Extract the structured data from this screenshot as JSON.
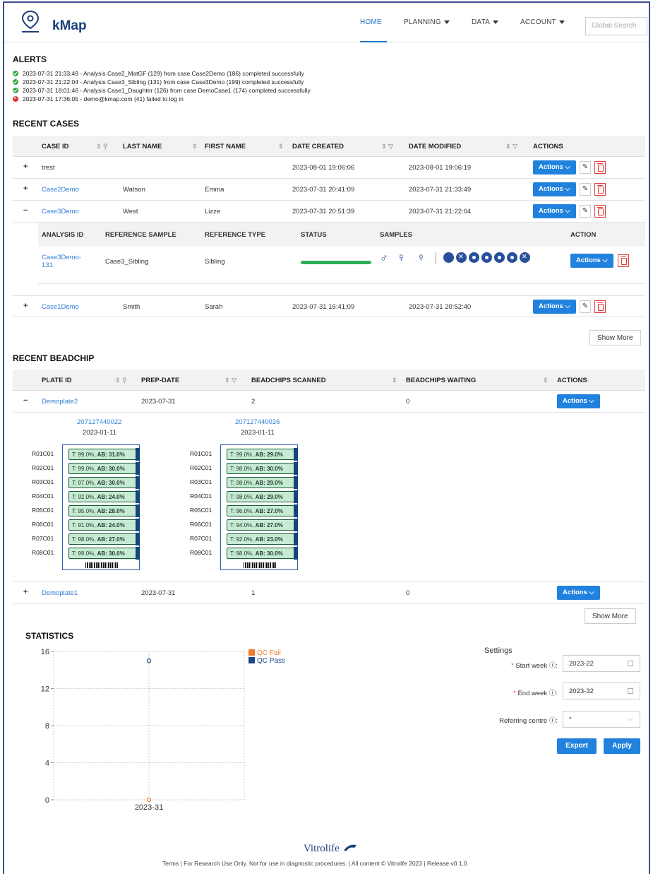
{
  "header": {
    "brand": "kMap",
    "nav": [
      {
        "label": "HOME",
        "dropdown": false,
        "active": true
      },
      {
        "label": "PLANNING",
        "dropdown": true
      },
      {
        "label": "DATA",
        "dropdown": true
      },
      {
        "label": "ACCOUNT",
        "dropdown": true
      }
    ],
    "search_placeholder": "Global Search"
  },
  "alerts": {
    "title": "ALERTS",
    "items": [
      {
        "status": "success",
        "text": "2023-07-31 21:33:49 - Analysis Case2_MatGF (129) from case Case2Demo (186) completed successfully"
      },
      {
        "status": "success",
        "text": "2023-07-31 21:22:04 - Analysis Case3_Sibling (131) from case Case3Demo (199) completed successfully"
      },
      {
        "status": "success",
        "text": "2023-07-31 18:01:46 - Analysis Case1_Daughter (126) from case DemoCase1 (174) completed successfully"
      },
      {
        "status": "fail",
        "text": "2023-07-31 17:36:05 - demo@kmap.com (41) failed to log in"
      }
    ]
  },
  "recent_cases": {
    "title": "RECENT CASES",
    "columns": [
      "CASE ID",
      "LAST NAME",
      "FIRST NAME",
      "DATE CREATED",
      "DATE MODIFIED",
      "ACTIONS"
    ],
    "rows": [
      {
        "expand": "+",
        "case_id": "trest",
        "last": "",
        "first": "",
        "created": "2023-08-01 19:06:06",
        "modified": "2023-08-01 19:06:19"
      },
      {
        "expand": "+",
        "case_id": "Case2Demo",
        "last": "Watson",
        "first": "Emma",
        "created": "2023-07-31 20:41:09",
        "modified": "2023-07-31 21:33:49"
      },
      {
        "expand": "−",
        "case_id": "Case3Demo",
        "last": "West",
        "first": "Lizze",
        "created": "2023-07-31 20:51:39",
        "modified": "2023-07-31 21:22:04"
      },
      {
        "expand": "+",
        "case_id": "Case1Demo",
        "last": "Smith",
        "first": "Sarah",
        "created": "2023-07-31 16:41:09",
        "modified": "2023-07-31 20:52:40"
      }
    ],
    "actions_label": "Actions",
    "sub": {
      "columns": [
        "ANALYSIS ID",
        "REFERENCE SAMPLE",
        "REFERENCE TYPE",
        "STATUS",
        "SAMPLES",
        "ACTION"
      ],
      "row": {
        "analysis_id_1": "Case3Demo-",
        "analysis_id_2": "131",
        "ref_sample": "Case3_Sibling",
        "ref_type": "Sibling",
        "status_progress": 1.0
      }
    },
    "show_more": "Show More"
  },
  "recent_beadchip": {
    "title": "RECENT BEADCHIP",
    "columns": [
      "PLATE ID",
      "PREP-DATE",
      "BEADCHIPS SCANNED",
      "BEADCHIPS WAITING",
      "ACTIONS"
    ],
    "rows": [
      {
        "expand": "−",
        "plate_id": "Demoplate2",
        "prep": "2023-07-31",
        "scanned": "2",
        "waiting": "0"
      },
      {
        "expand": "+",
        "plate_id": "Demoplate1",
        "prep": "2023-07-31",
        "scanned": "1",
        "waiting": "0"
      }
    ],
    "chips": [
      {
        "id": "207127440022",
        "date": "2023-01-11",
        "rows": [
          {
            "pos": "R01C01",
            "t": "T: 99.0%,",
            "ab": "AB: 31.0%"
          },
          {
            "pos": "R02C01",
            "t": "T: 99.0%,",
            "ab": "AB: 30.0%"
          },
          {
            "pos": "R03C01",
            "t": "T: 97.0%,",
            "ab": "AB: 30.0%"
          },
          {
            "pos": "R04C01",
            "t": "T: 92.0%,",
            "ab": "AB: 24.0%"
          },
          {
            "pos": "R05C01",
            "t": "T: 95.0%,",
            "ab": "AB: 28.0%"
          },
          {
            "pos": "R06C01",
            "t": "T: 91.0%,",
            "ab": "AB: 24.0%"
          },
          {
            "pos": "R07C01",
            "t": "T: 98.0%,",
            "ab": "AB: 27.0%"
          },
          {
            "pos": "R08C01",
            "t": "T: 99.0%,",
            "ab": "AB: 30.0%"
          }
        ]
      },
      {
        "id": "207127440026",
        "date": "2023-01-11",
        "rows": [
          {
            "pos": "R01C01",
            "t": "T: 99.0%,",
            "ab": "AB: 29.0%"
          },
          {
            "pos": "R02C01",
            "t": "T: 98.0%,",
            "ab": "AB: 30.0%"
          },
          {
            "pos": "R03C01",
            "t": "T: 98.0%,",
            "ab": "AB: 29.0%"
          },
          {
            "pos": "R04C01",
            "t": "T: 98.0%,",
            "ab": "AB: 29.0%"
          },
          {
            "pos": "R05C01",
            "t": "T: 96.0%,",
            "ab": "AB: 27.0%"
          },
          {
            "pos": "R06C01",
            "t": "T: 94.0%,",
            "ab": "AB: 27.0%"
          },
          {
            "pos": "R07C01",
            "t": "T: 92.0%,",
            "ab": "AB: 23.0%"
          },
          {
            "pos": "R08C01",
            "t": "T: 98.0%,",
            "ab": "AB: 30.0%"
          }
        ]
      }
    ],
    "show_more": "Show More"
  },
  "statistics": {
    "title": "STATISTICS",
    "settings_title": "Settings",
    "start_week_label": "Start week",
    "start_week": "2023-22",
    "end_week_label": "End week",
    "end_week": "2023-32",
    "centre_label": "Referring centre",
    "centre": "*",
    "export": "Export",
    "apply": "Apply"
  },
  "chart_data": {
    "type": "scatter",
    "categories": [
      "2023-31"
    ],
    "series": [
      {
        "name": "QC Fail",
        "color": "#f07c2c",
        "values": [
          0
        ]
      },
      {
        "name": "QC Pass",
        "color": "#1c4687",
        "values": [
          15
        ]
      }
    ],
    "ylim": [
      0,
      16
    ],
    "yticks": [
      "16",
      "12",
      "8",
      "4",
      "0"
    ],
    "legend": "top-right",
    "grid": true
  },
  "footer": {
    "brand": "Vitrolife",
    "text": "Terms | For Research Use Only. Not for use in diagnostic procedures. | All content © Vitrolife 2023 | Release v0.1.0"
  }
}
